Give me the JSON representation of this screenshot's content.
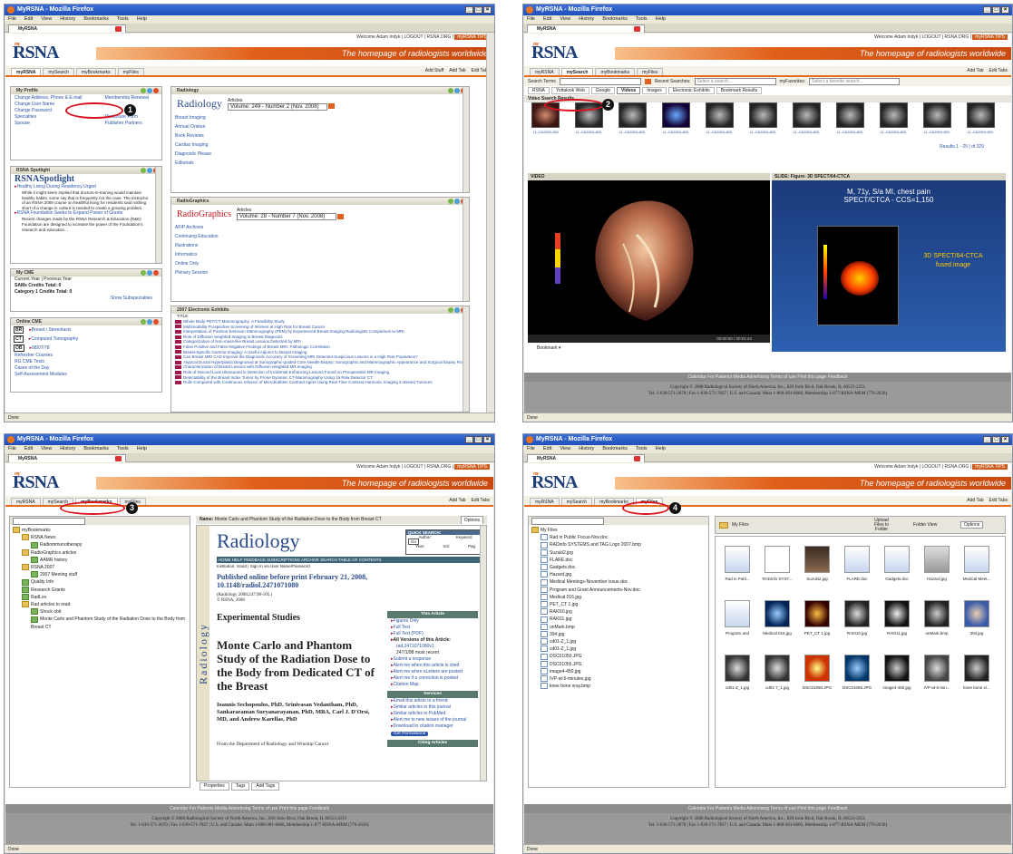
{
  "browser": {
    "title": "MyRSNA - Mozilla Firefox",
    "menu": [
      "File",
      "Edit",
      "View",
      "History",
      "Bookmarks",
      "Tools",
      "Help"
    ],
    "tab": "MyRSNA",
    "status": "Done"
  },
  "site": {
    "welcome": "Welcome Adam Indyk",
    "logout": "LOGOUT",
    "rsnaorg": "RSNA.ORG",
    "tips": "myRSNA TIPS",
    "logo_my": "my",
    "logo": "RSNA",
    "tagline": "The homepage of radiologists worldwide",
    "tabs": [
      "myRSNA",
      "mySearch",
      "myBookmarks",
      "myFiles"
    ],
    "add_stuff": "Add Stuff",
    "add_tab": "Add Tab",
    "edit_tabs": "Edit Tabs"
  },
  "footer": {
    "links": "Calendar   For Patients   Media   Advertising   Terms of use   Print this page   Feedback",
    "copy1": "Copyright © 2008 Radiological Society of North America, Inc., 820 Jorie Blvd, Oak Brook, IL 60523-2251",
    "copy2": "Tel. 1-630-571-2670 | Fax 1-630-571-7837 | U.S. and Canada: Main 1-800-381-6660, Membership 1-877-RSNA-MEM (776-2636)"
  },
  "callouts": [
    "1",
    "2",
    "3",
    "4"
  ],
  "s1": {
    "profile": {
      "title": "My Profile",
      "links_left": [
        "Change Address, Phone & E-mail",
        "Change User Name",
        "Change Password",
        "Specialties",
        "Spouse"
      ],
      "links_right": [
        "Membership Renewal",
        "Disclosure Form",
        "Publisher Partners"
      ]
    },
    "spotlight": {
      "title": "RSNA Spotlight",
      "logo": "RSNASpotlight",
      "items": [
        "Healthy Living During Residency Urged",
        "RSNA Foundation Seeks to Expand Power of Grants"
      ],
      "body": "While it might seem implied that doctors-in-training would maintain healthy habits, some say that is frequently not the case. The instructor of an RSNA 2008 course on healthful living for residents said nothing short of a change in culture is needed to create a growing problem.",
      "body2": "Recent changes made by the RSNA Research & Education (R&E) Foundation are designed to increase the power of the Foundation's research and education..."
    },
    "cme": {
      "title": "My CME",
      "line1": "Current Year | Previous Year",
      "line2": "SAMs Credits Total: 0",
      "line3": "Category 1 Credits Total: 0",
      "link": "Show Subspecialties"
    },
    "online_cme": {
      "title": "Online CME",
      "items": [
        "Breast / Stereotaxis",
        "Computed Tomography",
        "08/07/78"
      ],
      "badges": [
        "BR",
        "CT",
        "OB"
      ],
      "links": [
        "Refresher Courses",
        "RG CME Tests",
        "Cases of the Day",
        "Self-Assessment Modules"
      ]
    },
    "radiology": {
      "title": "Radiology",
      "name": "Radiology",
      "articles": "Articles",
      "volume": "Volume: 249 - Number 2 (Nov. 2008)",
      "links": [
        "Breast Imaging",
        "Annual Oration",
        "Book Reviews",
        "Cardiac Imaging",
        "Diagnostic Please",
        "Editorials"
      ]
    },
    "radiographics": {
      "title": "RadioGraphics",
      "name": "RadioGraphics",
      "articles": "Articles",
      "volume": "Volume: 28 - Number 7 (Nov. 2008)",
      "links": [
        "AFIP Archives",
        "Continuing Education",
        "Illustrations",
        "Informatics",
        "Online Only",
        "Plenary Session"
      ]
    },
    "exhibits": {
      "title": "2007 Electronic Exhibits",
      "col": "TITLE",
      "items": [
        "Whole Body PET/CT Mammography: A Feasibility Study",
        "Multimodality Prospective Screening of Women at High Risk for Breast Cancer",
        "Interpretation of Positron Emission Mammography (PEM) by Experienced Breast Imaging Radiologists Comparison to MRI",
        "Role of Diffusion weighted Imaging in Breast Diagnosis",
        "Categorization of Non-mass-like Breast Lesions Detected by MRI",
        "False Positive and False Negative Findings of Breast MRI: Pathologic Correlation",
        "Breast-Specific Gamma Imaging: A Useful Adjunct to Breast Imaging",
        "Can Breast MRI CAD Improve the Diagnostic Accuracy of Screening MRI Detected Suspicious Lesions in a High Risk Population?",
        "Atypical Ductal Hyperplasia Diagnosed at Sonographic-guided Core Needle Biopsy: Sonographic and Mammographic Appearance and Surgical Biopsy Findings",
        "Characterization of Breast Lesions with Diffusion-weighted MR Imaging",
        "Role of Second Look Ultrasound in Detection of Incidental Enhancing Lesions Found on Preoperative MR Imaging",
        "Detectability of the Breast Index Tumor by Prone Dynamic CT-Mammography Using 16 Row Detector CT",
        "Rolls Compared with Continuous Infusion of Microbubbles Contrast Agent Using Real Time Contrast Harmonic Imaging in Breast Tumours"
      ]
    }
  },
  "s2": {
    "search_terms": "Search Terms",
    "recent_label": "Recent Searches:",
    "recent_ph": "Select a search...",
    "fav_label": "myFavorites:",
    "fav_ph": "Select a favorite search...",
    "engines": [
      "RSNA",
      "Yottalook Web",
      "Google",
      "Videos",
      "Images",
      "Electronic Exhibits",
      "Bookmark Results"
    ],
    "results_header": "Video Search Results",
    "thumbs": [
      "LL-CA2002-802",
      "LL-CA2003-803",
      "LL-CA2003-803",
      "LL-CA2003-803",
      "LL-CA2003-803",
      "LL-CA2003-803",
      "LL-CA2003-803",
      "LL-CA2003-803",
      "LL-CA2003-803",
      "LL-CA2004-804",
      "LL-CA2004-804"
    ],
    "paging": "Results 1 - 25 | of 329",
    "video_label": "VIDEO",
    "slide_label": "SLIDE: Figure- 3D SPECT/64-CTCA",
    "slide_line1": "M, 71y, S/a MI, chest pain",
    "slide_line2": "SPECT/CTCA  -  CCS=1,150",
    "slide_overlay1": "3D SPECT/64-CTCA",
    "slide_overlay2": "fused image",
    "timecode": "00:00:00 / 00:01:24",
    "bookmark": "Bookmark"
  },
  "s3": {
    "tree": [
      "myBookmarks",
      "RSNA News",
      "Radiommunotherapy",
      "RadioGraphics articles",
      "AAMR history",
      "RSNA 2007",
      "2007 Meeting stuff",
      "Quality Info",
      "Research Grants",
      "RadLex",
      "Rad articles to read",
      "Shock obit",
      "Monte Carlo and Phantom Study of the Radiation Dose to the Body from Breast CT"
    ],
    "name_label": "Name:",
    "name_value": "Monte Carlo and Phantom Study of the Radiation Dose to the Body from Breast CT",
    "options": "Options",
    "journal": "Radiology",
    "quick": "QUICK SEARCH:",
    "q_author": "Author:",
    "q_keyword": "Keyword",
    "q_year": "Year:",
    "q_vol": "Vol:",
    "q_page": "Pag",
    "go": "Go",
    "nav": "HOME   HELP   FEEDBACK   SUBSCRIPTIONS   ARCHIVE   SEARCH   TABLE OF CONTENTS",
    "inst": "Institution: rsna3  |  Sign In via User Name/Password",
    "pub": "Published online before print February 21, 2008,",
    "doi": "10.1148/radiol.2471071080",
    "cite": "(Radiology 2008;247:98-105.)",
    "copy": "© RSNA, 2008",
    "section": "Experimental Studies",
    "title": "Monte Carlo and Phantom Study of the Radiation Dose to the Body from Dedicated CT of the Breast",
    "authors": "Ioannis Sechopoulos, PhD, Srinivasan Vedantham, PhD, Sankararaman Suryanarayanan, PhD, MBA, Carl J. D'Orsi, MD, and Andrew Karellas, PhD",
    "from": "From the Department of Radiology and Winship Cancer",
    "this_article": "This Article",
    "art_links": [
      "Figures Only",
      "Full Text",
      "Full Text (PDF)",
      "All Versions of this Article:",
      "247/1/98    most recent",
      "Submit a response",
      "Alert me when this article is cited",
      "Alert me when eLetters are posted",
      "Alert me if a correction is posted",
      "Citation Map"
    ],
    "art_ver": "rad.2471071080v1",
    "services": "Services",
    "serv_links": [
      "Email this article to a friend",
      "Similar articles in this journal",
      "Similar articles in PubMed",
      "Alert me to new issues of the journal",
      "Download to citation manager"
    ],
    "perms": "Get Permissions",
    "citing": "Citing Articles",
    "bottom_tabs": [
      "Properties",
      "Tags",
      "Add Tags"
    ]
  },
  "s4": {
    "tree": [
      "My Files",
      "Rad in Public Focus-Nov.doc",
      "RADinfo SYSTEMS and TAG Logo 2007.bmp",
      "Suzuki2.jpg",
      "FLARE.doc",
      "Gadgets.doc",
      "Hazard.jpg",
      "Medical Meetings-November issue.doc",
      "Program and Grant Announcements-Nov.doc",
      "Medical 016.jpg",
      "PET_CT 1.jpg",
      "RAI010.jpg",
      "RAI011.jpg",
      "unMark.bmp",
      "394.jpg",
      "cd01-Z_1.jpg",
      "cd01-Z_1.jpg",
      "DSC01050.JPG",
      "DSC01055.JPG",
      "image4-450.jpg",
      "IVP-at-5-minutes.jpg",
      "knee bone xray.bmp"
    ],
    "folder": "My Files",
    "upload": "Upload Files to Folder",
    "folder_view": "Folder View",
    "options": "Options",
    "files": [
      "Rad in Publ...",
      "RADinfo SYST...",
      "Suzuki2.jpg",
      "FLARE.doc",
      "Gadgets.doc",
      "Hazard.jpg",
      "Medical Meet...",
      "Program and",
      "Medical 016.jpg",
      "PET_CT 1.jpg",
      "RAI010.jpg",
      "RAI011.jpg",
      "unMark.bmp",
      "394.jpg",
      "cd01-Z_1.jpg",
      "cd01-7_1.jpg",
      "DSC01050.JPG",
      "DSC01055.JPG",
      "image4-450.jpg",
      "IVP-at-5-min...",
      "knee bone xr..."
    ]
  }
}
